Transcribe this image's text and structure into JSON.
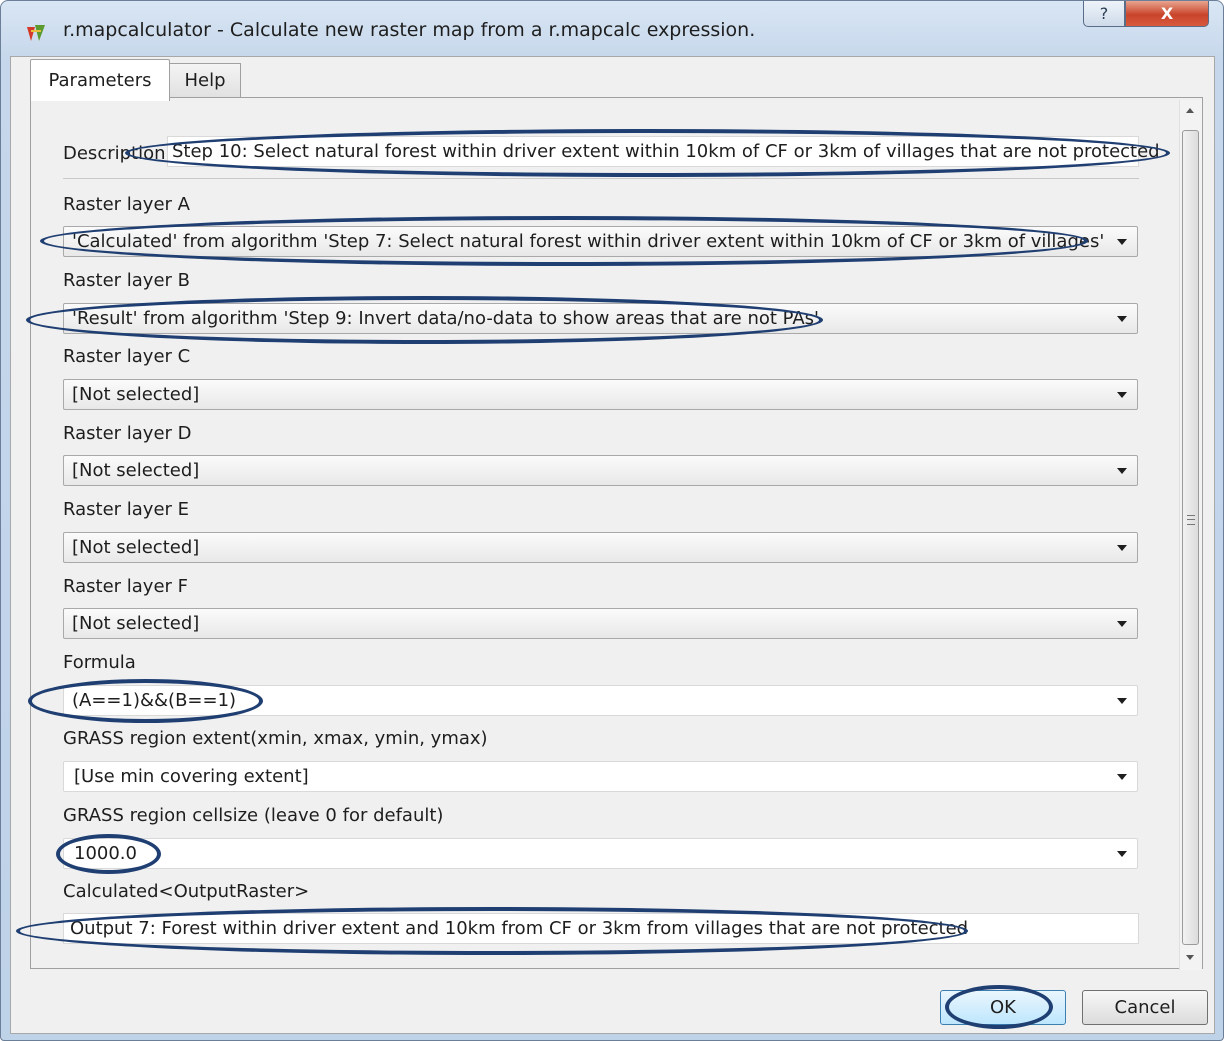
{
  "window": {
    "title": "r.mapcalculator - Calculate new raster map from a r.mapcalc expression.",
    "help_label": "?",
    "close_label": "X"
  },
  "tabs": [
    {
      "label": "Parameters",
      "active": true
    },
    {
      "label": "Help",
      "active": false
    }
  ],
  "form": {
    "description": {
      "label": "Description",
      "value": "Step 10: Select natural forest within driver extent within 10km of CF or 3km of villages that are not protected"
    },
    "raster_a": {
      "label": "Raster layer A",
      "value": "'Calculated' from algorithm 'Step 7: Select natural forest within driver extent within 10km of CF or 3km of villages'"
    },
    "raster_b": {
      "label": "Raster layer B",
      "value": "'Result' from algorithm 'Step 9: Invert data/no-data to show areas that are not PAs'"
    },
    "raster_c": {
      "label": "Raster layer C",
      "value": "[Not selected]"
    },
    "raster_d": {
      "label": "Raster layer D",
      "value": "[Not selected]"
    },
    "raster_e": {
      "label": "Raster layer E",
      "value": "[Not selected]"
    },
    "raster_f": {
      "label": "Raster layer F",
      "value": "[Not selected]"
    },
    "formula": {
      "label": "Formula",
      "value": "(A==1)&&(B==1)"
    },
    "region_extent": {
      "label": "GRASS region extent(xmin, xmax, ymin, ymax)",
      "value": "[Use min covering extent]"
    },
    "cellsize": {
      "label": "GRASS region cellsize (leave 0 for default)",
      "value": "1000.0"
    },
    "output": {
      "label": "Calculated<OutputRaster>",
      "value": "Output 7: Forest within driver extent and 10km from CF or 3km from villages that are not protected"
    }
  },
  "buttons": {
    "ok": "OK",
    "cancel": "Cancel"
  },
  "colors": {
    "annotation_ellipse": "#1f3e72",
    "close_button": "#c8442a"
  }
}
